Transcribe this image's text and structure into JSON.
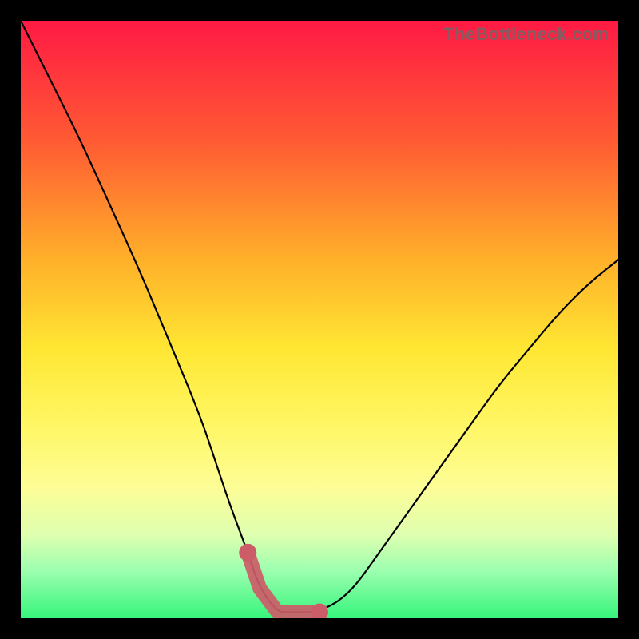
{
  "watermark": "TheBottleneck.com",
  "colors": {
    "background": "#000000",
    "gradient_top": "#ff1a44",
    "gradient_bottom": "#36f57c",
    "curve": "#000000",
    "emphasis": "#cc5c68"
  },
  "chart_data": {
    "type": "line",
    "title": "",
    "xlabel": "",
    "ylabel": "",
    "xlim": [
      0,
      100
    ],
    "ylim": [
      0,
      100
    ],
    "grid": false,
    "legend": false,
    "series": [
      {
        "name": "bottleneck-curve",
        "x": [
          0,
          5,
          10,
          15,
          20,
          25,
          30,
          33,
          35,
          38,
          40,
          43,
          45,
          50,
          55,
          60,
          65,
          70,
          75,
          80,
          85,
          90,
          95,
          100
        ],
        "values": [
          100,
          90,
          80,
          69,
          58,
          46,
          34,
          25,
          19,
          11,
          5,
          1,
          1,
          1,
          4,
          11,
          18,
          25,
          32,
          39,
          45,
          51,
          56,
          60
        ]
      }
    ],
    "emphasis_region": {
      "x_start": 38,
      "x_end": 50
    }
  }
}
